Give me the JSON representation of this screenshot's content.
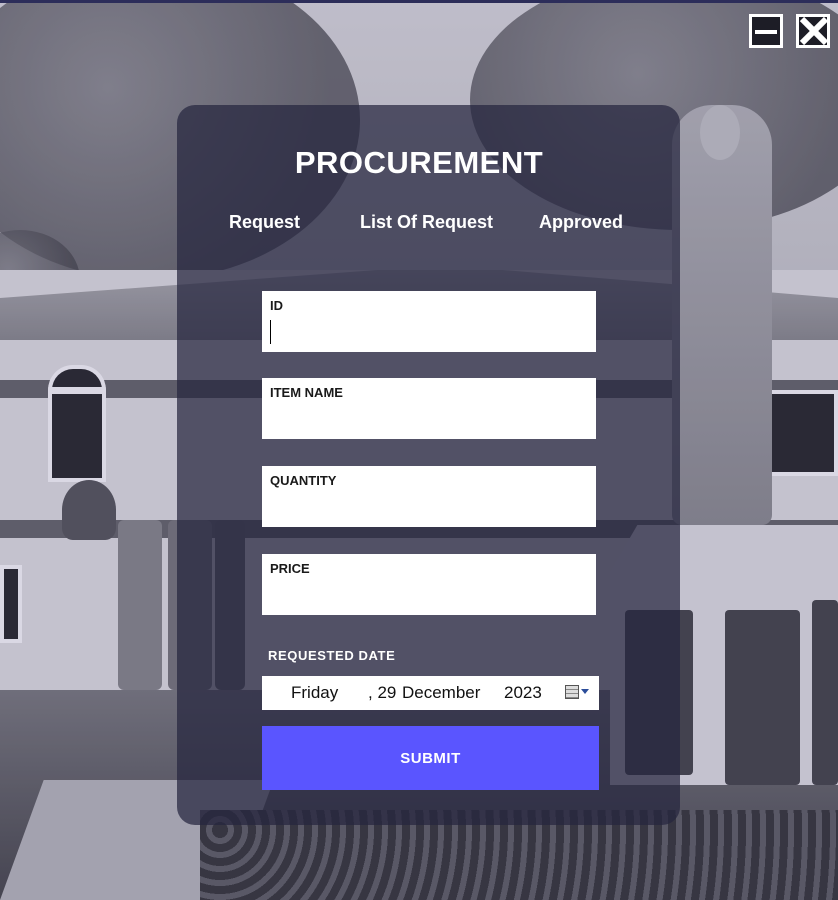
{
  "window": {
    "minimize_icon": "minimize-icon",
    "close_icon": "close-icon"
  },
  "header": {
    "title": "PROCUREMENT"
  },
  "tabs": [
    {
      "label": "Request"
    },
    {
      "label": "List Of Request"
    },
    {
      "label": "Approved"
    }
  ],
  "form": {
    "id": {
      "label": "ID",
      "value": ""
    },
    "item_name": {
      "label": "ITEM NAME",
      "value": ""
    },
    "quantity": {
      "label": "QUANTITY",
      "value": ""
    },
    "price": {
      "label": "PRICE",
      "value": ""
    },
    "requested_date": {
      "label": "REQUESTED DATE",
      "day_name": "Friday",
      "day": ", 29",
      "month": "December",
      "year": "2023",
      "icon": "calendar-icon"
    },
    "submit_label": "SUBMIT"
  },
  "colors": {
    "panel": "#26263e",
    "submit": "#5a55ff",
    "text": "#ffffff"
  }
}
